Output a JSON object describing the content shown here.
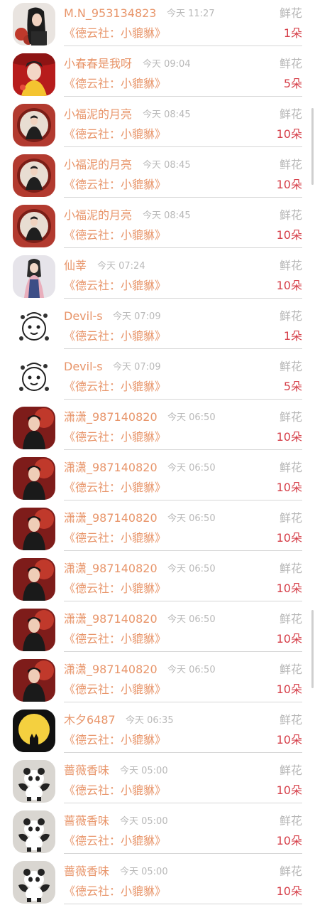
{
  "colors": {
    "name": "#e8956a",
    "work": "#e8956a",
    "time": "#b9b9b9",
    "gift": "#b5b5b5",
    "count": "#d6404a",
    "divider": "#d6d6d6"
  },
  "rows": [
    {
      "name": "M.N_953134823",
      "time": "今天 11:27",
      "gift": "鲜花",
      "work": "《德云社：小貔貅》",
      "count": "1朵",
      "avatar": "avatar-girl-red-flowers"
    },
    {
      "name": "小春春是我呀",
      "time": "今天 09:04",
      "gift": "鲜花",
      "work": "《德云社：小貔貅》",
      "count": "5朵",
      "avatar": "avatar-costume-red"
    },
    {
      "name": "小福泥的月亮",
      "time": "今天 08:45",
      "gift": "鲜花",
      "work": "《德云社：小貔貅》",
      "count": "10朵",
      "avatar": "avatar-performer-red-frame"
    },
    {
      "name": "小福泥的月亮",
      "time": "今天 08:45",
      "gift": "鲜花",
      "work": "《德云社：小貔貅》",
      "count": "10朵",
      "avatar": "avatar-performer-red-frame"
    },
    {
      "name": "小福泥的月亮",
      "time": "今天 08:45",
      "gift": "鲜花",
      "work": "《德云社：小貔貅》",
      "count": "10朵",
      "avatar": "avatar-performer-red-frame"
    },
    {
      "name": "仙莘",
      "time": "今天 07:24",
      "gift": "鲜花",
      "work": "《德云社：小貔貅》",
      "count": "10朵",
      "avatar": "avatar-hanfu-girl"
    },
    {
      "name": "Devil-s",
      "time": "今天 07:09",
      "gift": "鲜花",
      "work": "《德云社：小貔貅》",
      "count": "1朵",
      "avatar": "avatar-cartoon-doodle"
    },
    {
      "name": "Devil-s",
      "time": "今天 07:09",
      "gift": "鲜花",
      "work": "《德云社：小貔貅》",
      "count": "5朵",
      "avatar": "avatar-cartoon-doodle"
    },
    {
      "name": "潇潇_987140820",
      "time": "今天 06:50",
      "gift": "鲜花",
      "work": "《德云社：小貔貅》",
      "count": "10朵",
      "avatar": "avatar-man-dark-red"
    },
    {
      "name": "潇潇_987140820",
      "time": "今天 06:50",
      "gift": "鲜花",
      "work": "《德云社：小貔貅》",
      "count": "10朵",
      "avatar": "avatar-man-dark-red"
    },
    {
      "name": "潇潇_987140820",
      "time": "今天 06:50",
      "gift": "鲜花",
      "work": "《德云社：小貔貅》",
      "count": "10朵",
      "avatar": "avatar-man-dark-red"
    },
    {
      "name": "潇潇_987140820",
      "time": "今天 06:50",
      "gift": "鲜花",
      "work": "《德云社：小貔貅》",
      "count": "10朵",
      "avatar": "avatar-man-dark-red"
    },
    {
      "name": "潇潇_987140820",
      "time": "今天 06:50",
      "gift": "鲜花",
      "work": "《德云社：小貔貅》",
      "count": "10朵",
      "avatar": "avatar-man-dark-red"
    },
    {
      "name": "潇潇_987140820",
      "time": "今天 06:50",
      "gift": "鲜花",
      "work": "《德云社：小貔貅》",
      "count": "10朵",
      "avatar": "avatar-man-dark-red"
    },
    {
      "name": "木夕6487",
      "time": "今天 06:35",
      "gift": "鲜花",
      "work": "《德云社：小貔貅》",
      "count": "10朵",
      "avatar": "avatar-cat-moon"
    },
    {
      "name": "蔷薇香味",
      "time": "今天 05:00",
      "gift": "鲜花",
      "work": "《德云社：小貔貅》",
      "count": "10朵",
      "avatar": "avatar-panda"
    },
    {
      "name": "蔷薇香味",
      "time": "今天 05:00",
      "gift": "鲜花",
      "work": "《德云社：小貔貅》",
      "count": "10朵",
      "avatar": "avatar-panda"
    },
    {
      "name": "蔷薇香味",
      "time": "今天 05:00",
      "gift": "鲜花",
      "work": "《德云社：小貔貅》",
      "count": "10朵",
      "avatar": "avatar-panda"
    }
  ]
}
